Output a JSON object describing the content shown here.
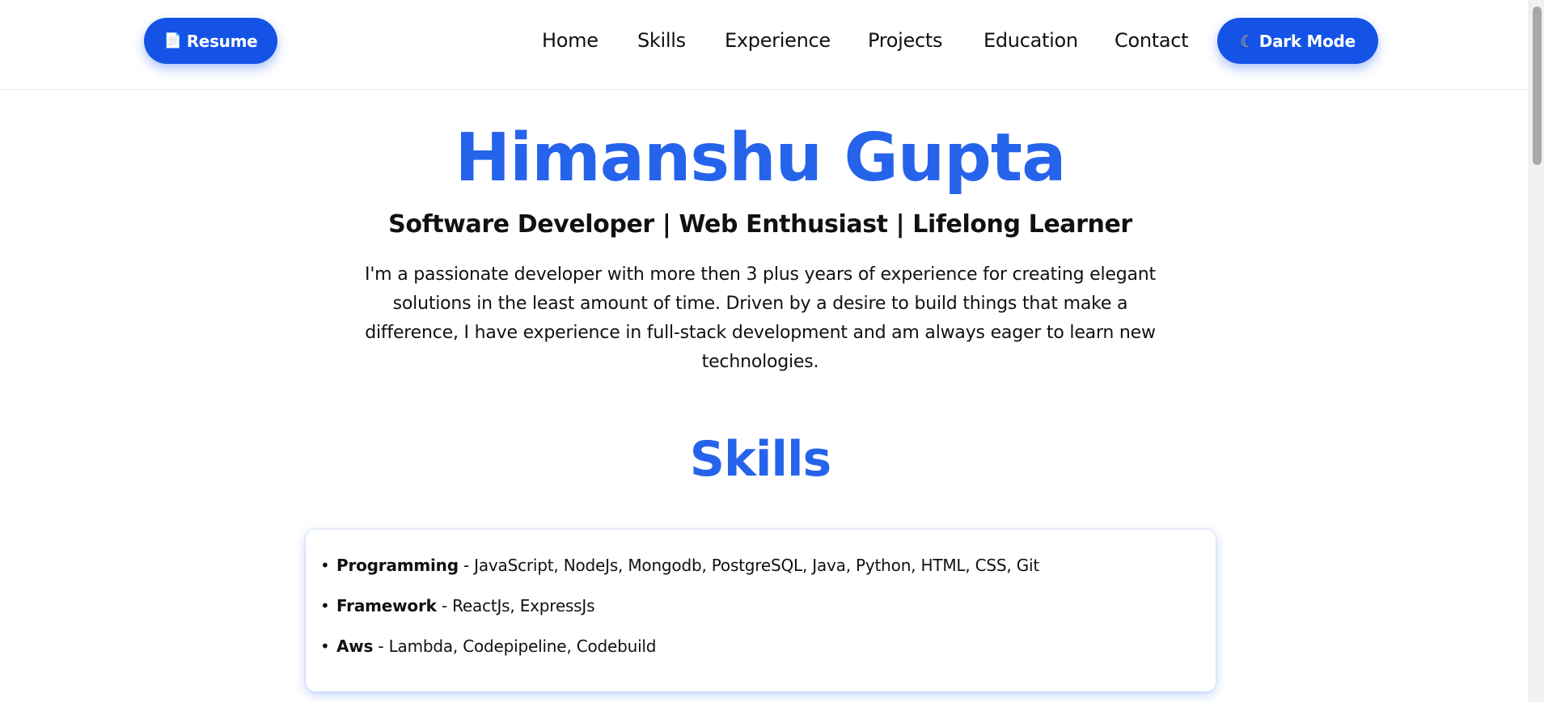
{
  "header": {
    "resume_icon": "document-icon",
    "resume_label": "Resume",
    "nav": [
      "Home",
      "Skills",
      "Experience",
      "Projects",
      "Education",
      "Contact"
    ],
    "dark_mode_icon": "moon-icon",
    "dark_mode_label": "Dark Mode"
  },
  "hero": {
    "name": "Himanshu Gupta",
    "subtitle": "Software Developer | Web Enthusiast | Lifelong Learner",
    "description": "I'm a passionate developer with more then 3 plus years of experience for creating elegant solutions in the least amount of time. Driven by a desire to build things that make a difference, I have experience in full-stack development and am always eager to learn new technologies."
  },
  "skills": {
    "title": "Skills",
    "items": [
      {
        "name": "Programming",
        "values": " - JavaScript, NodeJs, Mongodb, PostgreSQL, Java, Python, HTML, CSS, Git"
      },
      {
        "name": "Framework",
        "values": " - ReactJs, ExpressJs"
      },
      {
        "name": "Aws",
        "values": " - Lambda, Codepipeline, Codebuild"
      }
    ]
  },
  "colors": {
    "accent": "#2563eb",
    "button": "#1453e6"
  }
}
